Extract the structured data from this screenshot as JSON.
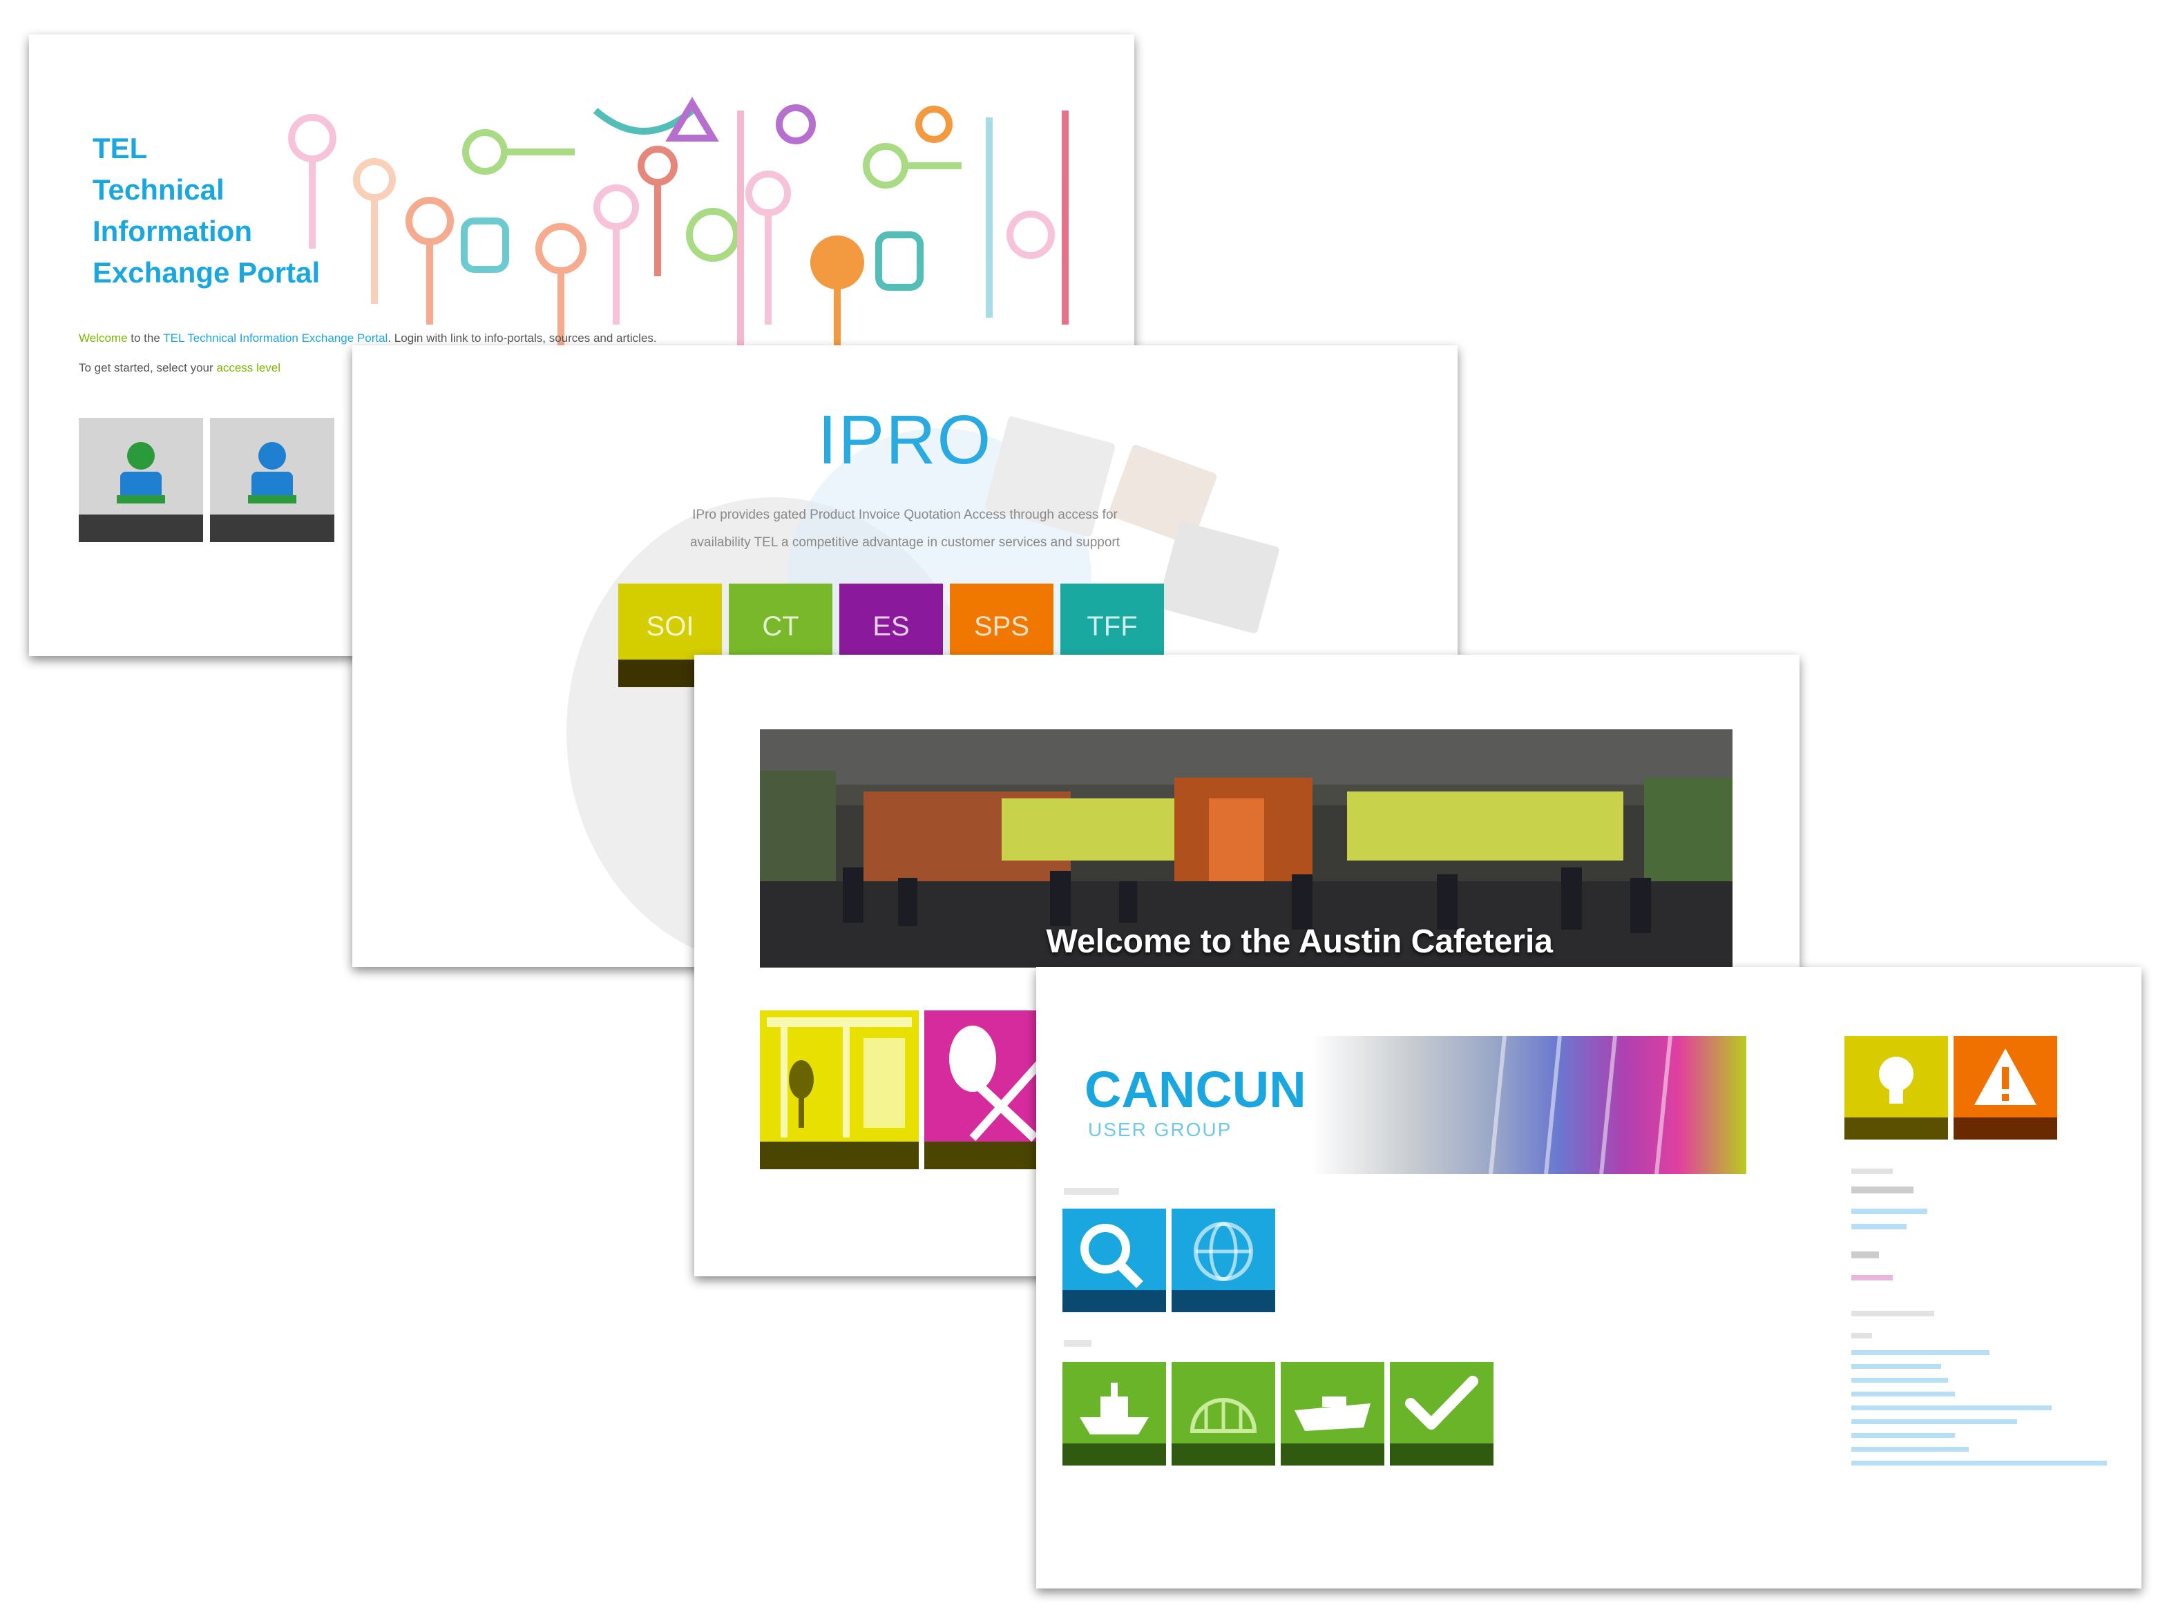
{
  "tix": {
    "title_lines": [
      "TEL",
      "Technical",
      "Information",
      "Exchange Portal"
    ],
    "welcome_prefix": "Welcome",
    "welcome_mid": "to the",
    "welcome_link": "TEL Technical Information Exchange Portal",
    "welcome_rest": ". Login with link to info-portals, sources and articles.",
    "login_prefix": "To get started, select your",
    "login_link": "access level",
    "tiles": [
      {
        "color": "#2a9a3a"
      },
      {
        "color": "#1f7fd0"
      }
    ]
  },
  "ipro": {
    "title": "IPRO",
    "desc_line1": "IPro provides gated Product Invoice Quotation Access through access for",
    "desc_line2": "availability TEL a competitive advantage in customer services and support",
    "tiles": [
      {
        "label": "SOI",
        "color": "#d4cd00"
      },
      {
        "label": "CT",
        "color": "#78b82a"
      },
      {
        "label": "ES",
        "color": "#8a1a9b"
      },
      {
        "label": "SPS",
        "color": "#f07800"
      },
      {
        "label": "TFF",
        "color": "#1aa9a0"
      }
    ]
  },
  "cafe": {
    "caption": "Welcome to the Austin Cafeteria",
    "tiles": [
      {
        "color": "#e8e000",
        "icon": "menu-board-icon"
      },
      {
        "color": "#d62b9c",
        "icon": "utensils-icon"
      }
    ]
  },
  "cancun": {
    "title": "CANCUN",
    "subtitle": "USER GROUP",
    "row1_tiles": [
      {
        "icon": "search-icon",
        "color": "#1aa7e0"
      },
      {
        "icon": "globe-icon",
        "color": "#1aa7e0"
      }
    ],
    "row2_tiles": [
      {
        "icon": "ship-icon",
        "color": "#6ab42a"
      },
      {
        "icon": "dome-icon",
        "color": "#6ab42a"
      },
      {
        "icon": "boat-icon",
        "color": "#6ab42a"
      },
      {
        "icon": "check-icon",
        "color": "#6ab42a"
      }
    ],
    "side_tiles": [
      {
        "icon": "lightbulb-icon",
        "color": "#d8cc00"
      },
      {
        "icon": "warning-icon",
        "color": "#f07000"
      }
    ]
  }
}
